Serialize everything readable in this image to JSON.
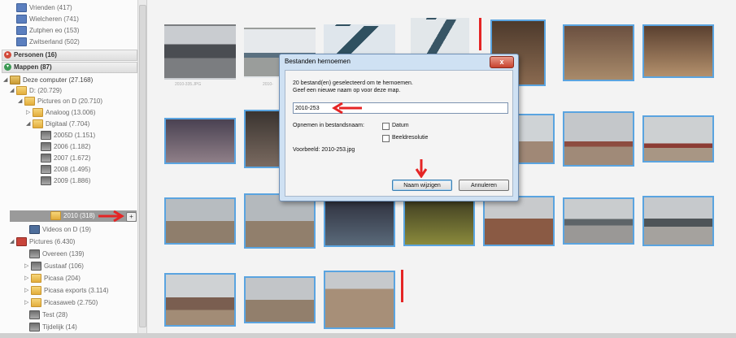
{
  "sidebar": {
    "items": [
      {
        "label": "Vrienden (417)",
        "icon": "person-icon"
      },
      {
        "label": "Wielcheren (741)",
        "icon": "person-icon"
      },
      {
        "label": "Zutphen eo (153)",
        "icon": "person-icon"
      },
      {
        "label": "Zwitserland (502)",
        "icon": "person-icon"
      }
    ],
    "personen_header": "Personen (16)",
    "mappen_header": "Mappen (87)",
    "computer": "Deze computer (27.168)",
    "drive_d": "D: (20.729)",
    "pictures_on_d": "Pictures on D (20.710)",
    "analoog": "Analoog (13.006)",
    "digitaal": "Digitaal (7.704)",
    "years": [
      "2005D (1.151)",
      "2006 (1.182)",
      "2007 (1.672)",
      "2008 (1.495)",
      "2009 (1.886)"
    ],
    "selected": "2010 (318)",
    "videos": "Videos on D (19)",
    "pictures": "Pictures (6.430)",
    "sub": [
      "Overeen (139)",
      "Gustaaf (106)",
      "Picasa (204)",
      "Picasa exports (3.114)",
      "Picasaweb (2.750)",
      "Test (28)",
      "Tijdelijk (14)"
    ]
  },
  "dialog": {
    "title": "Bestanden hernoemen",
    "close": "x",
    "line1": "20 bestand(en) geselecteerd om te hernoemen.",
    "line2": "Geef een nieuwe naam op voor deze map.",
    "input_value": "2010-253",
    "include_label": "Opnemen in bestandsnaam:",
    "opt_datum": "Datum",
    "opt_resolutie": "Beeldresolutie",
    "preview": "Voorbeeld: 2010-253.jpg",
    "ok_button": "Naam wijzigen",
    "cancel_button": "Annuleren"
  },
  "captions": {
    "c1": "2010-335.JPG",
    "c2": "2010-"
  },
  "colors": {
    "selection_border": "#5aa4e0",
    "annotation_red": "#e52525"
  }
}
